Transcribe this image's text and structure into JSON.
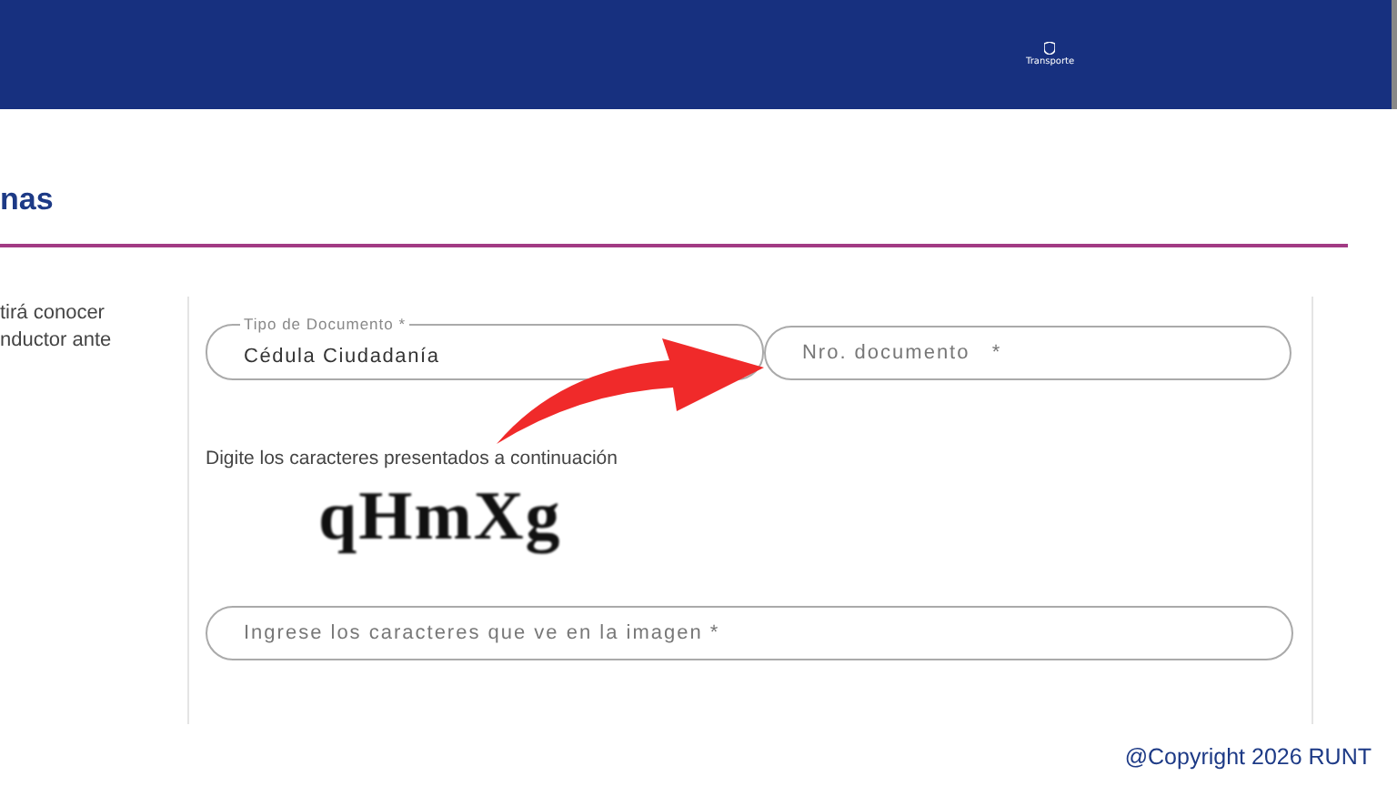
{
  "header": {
    "logo_text": "Transporte"
  },
  "section_title": "nas",
  "intro_lines": [
    "tirá conocer",
    "nductor ante"
  ],
  "form": {
    "fields": [
      {
        "label": "Tipo de Documento",
        "required_mark": "*",
        "value": "Cédula Ciudadanía"
      },
      {
        "placeholder": "Nro. documento   *"
      }
    ],
    "captcha_prompt": "Digite los caracteres presentados a continuación",
    "captcha_text": "qHmXg",
    "captcha_field": {
      "placeholder": "Ingrese los caracteres que ve en la imagen *"
    }
  },
  "footer": {
    "copyright": "@Copyright 2026 RUNT"
  }
}
